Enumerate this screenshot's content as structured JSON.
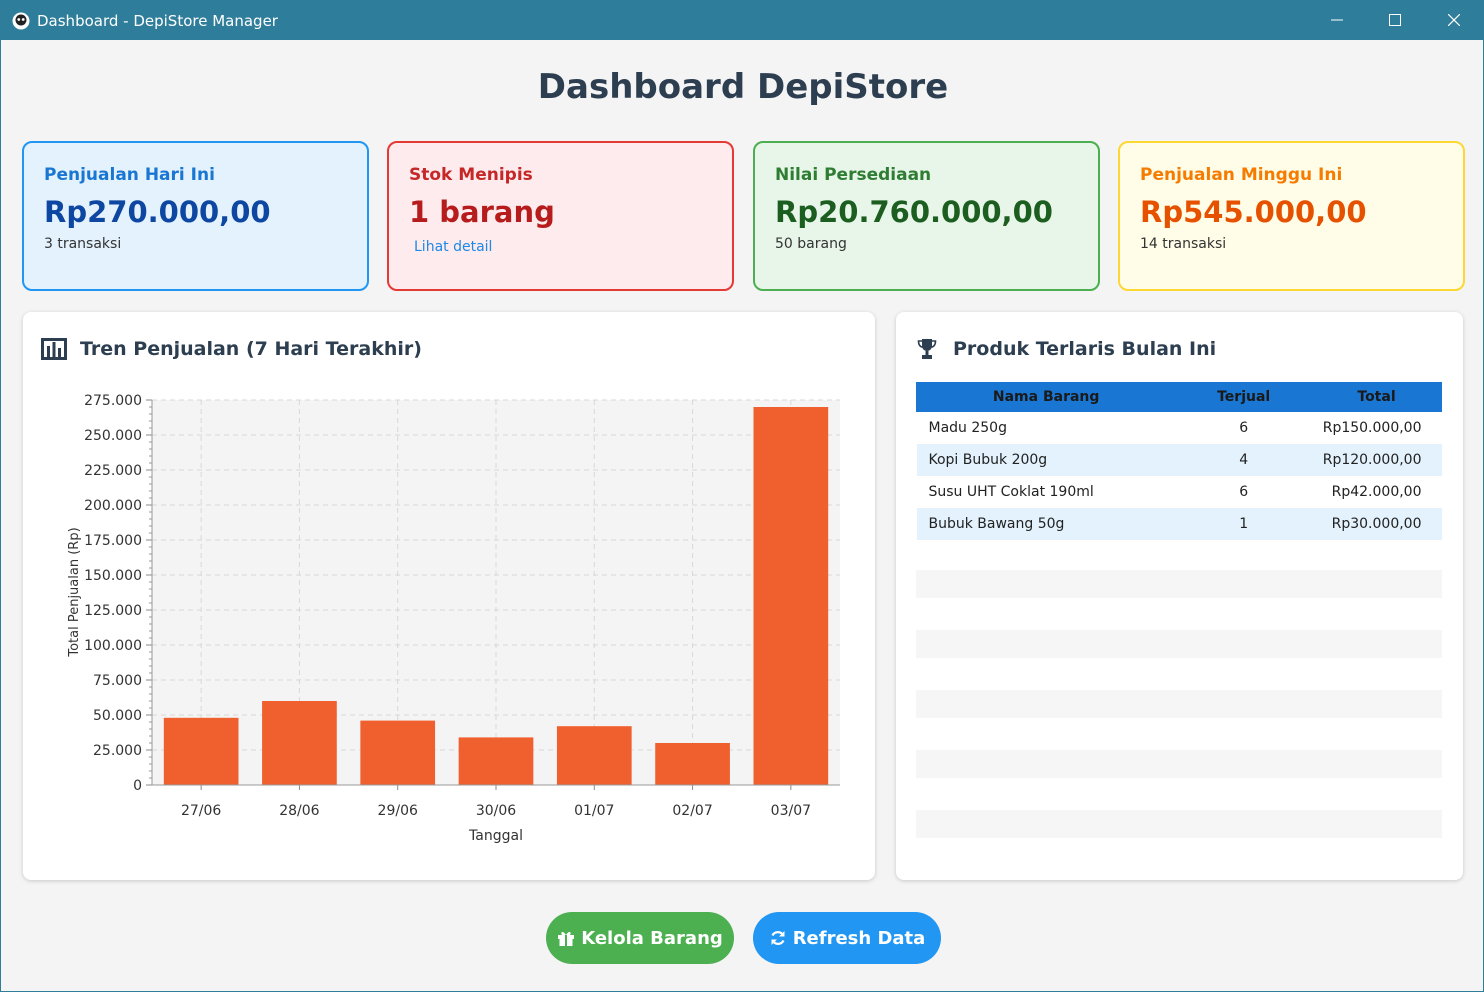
{
  "window": {
    "title": "Dashboard - DepiStore Manager"
  },
  "page": {
    "heading": "Dashboard DepiStore"
  },
  "cards": [
    {
      "label": "Penjualan Hari Ini",
      "value": "Rp270.000,00",
      "sub": "3 transaksi",
      "accent": "#2196f3"
    },
    {
      "label": "Stok Menipis",
      "value": "1 barang",
      "link": "Lihat detail",
      "accent": "#e53935"
    },
    {
      "label": "Nilai Persediaan",
      "value": "Rp20.760.000,00",
      "sub": "50 barang",
      "accent": "#4caf50"
    },
    {
      "label": "Penjualan Minggu Ini",
      "value": "Rp545.000,00",
      "sub": "14 transaksi",
      "accent": "#fdd835"
    }
  ],
  "chart_panel": {
    "title": "Tren Penjualan (7 Hari Terakhir)",
    "icon": "bar-chart-icon"
  },
  "chart_data": {
    "type": "bar",
    "categories": [
      "27/06",
      "28/06",
      "29/06",
      "30/06",
      "01/07",
      "02/07",
      "03/07"
    ],
    "values": [
      48000,
      60000,
      46000,
      34000,
      42000,
      30000,
      270000
    ],
    "xlabel": "Tanggal",
    "ylabel": "Total Penjualan (Rp)",
    "ylim": [
      0,
      275000
    ],
    "yticks": [
      0,
      25000,
      50000,
      75000,
      100000,
      125000,
      150000,
      175000,
      200000,
      225000,
      250000,
      275000
    ],
    "ytick_labels": [
      "0",
      "25.000",
      "50.000",
      "75.000",
      "100.000",
      "125.000",
      "150.000",
      "175.000",
      "200.000",
      "225.000",
      "250.000",
      "275.000"
    ],
    "grid": true,
    "bar_color": "#f05f2e"
  },
  "table_panel": {
    "title": "Produk Terlaris Bulan Ini",
    "icon": "trophy-icon",
    "columns": [
      "Nama Barang",
      "Terjual",
      "Total"
    ],
    "rows": [
      {
        "name": "Madu 250g",
        "qty": "6",
        "total": "Rp150.000,00"
      },
      {
        "name": "Kopi Bubuk 200g",
        "qty": "4",
        "total": "Rp120.000,00"
      },
      {
        "name": "Susu UHT Coklat 190ml",
        "qty": "6",
        "total": "Rp42.000,00"
      },
      {
        "name": "Bubuk Bawang 50g",
        "qty": "1",
        "total": "Rp30.000,00"
      }
    ]
  },
  "actions": {
    "manage_label": "Kelola Barang",
    "manage_icon": "gift-icon",
    "refresh_label": "Refresh Data",
    "refresh_icon": "refresh-icon"
  }
}
